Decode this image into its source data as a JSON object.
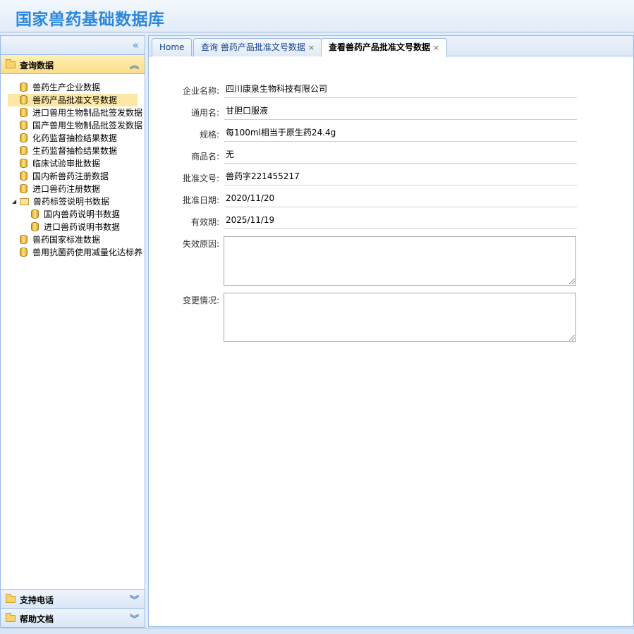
{
  "app": {
    "title": "国家兽药基础数据库"
  },
  "sidebar": {
    "collapse_icon": "double-chevron-left-icon",
    "sections": [
      {
        "label": "查询数据",
        "active": true
      },
      {
        "label": "支持电话",
        "active": false
      },
      {
        "label": "帮助文档",
        "active": false
      }
    ],
    "tree": [
      {
        "label": "兽药生产企业数据",
        "level": 1,
        "type": "db"
      },
      {
        "label": "兽药产品批准文号数据",
        "level": 1,
        "type": "db",
        "selected": true
      },
      {
        "label": "进口兽用生物制品批签发数据",
        "level": 1,
        "type": "db"
      },
      {
        "label": "国产兽用生物制品批签发数据",
        "level": 1,
        "type": "db"
      },
      {
        "label": "化药监督抽检结果数据",
        "level": 1,
        "type": "db"
      },
      {
        "label": "生药监督抽检结果数据",
        "level": 1,
        "type": "db"
      },
      {
        "label": "临床试验审批数据",
        "level": 1,
        "type": "db"
      },
      {
        "label": "国内新兽药注册数据",
        "level": 1,
        "type": "db"
      },
      {
        "label": "进口兽药注册数据",
        "level": 1,
        "type": "db"
      },
      {
        "label": "兽药标签说明书数据",
        "level": 1,
        "type": "folder",
        "expanded": true
      },
      {
        "label": "国内兽药说明书数据",
        "level": 2,
        "type": "db"
      },
      {
        "label": "进口兽药说明书数据",
        "level": 2,
        "type": "db"
      },
      {
        "label": "兽药国家标准数据",
        "level": 1,
        "type": "db"
      },
      {
        "label": "兽用抗菌药使用减量化达标养",
        "level": 1,
        "type": "db"
      }
    ]
  },
  "tabs": [
    {
      "label": "Home",
      "closable": false,
      "active": false
    },
    {
      "label": "查询 兽药产品批准文号数据",
      "closable": true,
      "active": false
    },
    {
      "label": "查看兽药产品批准文号数据",
      "closable": true,
      "active": true
    }
  ],
  "form": {
    "fields": [
      {
        "label": "企业名称:",
        "value": "四川康泉生物科技有限公司"
      },
      {
        "label": "通用名:",
        "value": "甘胆口服液"
      },
      {
        "label": "规格:",
        "value": "每100ml相当于原生药24.4g"
      },
      {
        "label": "商品名:",
        "value": "无"
      },
      {
        "label": "批准文号:",
        "value": "兽药字221455217"
      },
      {
        "label": "批准日期:",
        "value": "2020/11/20"
      },
      {
        "label": "有效期:",
        "value": "2025/11/19"
      }
    ],
    "textareas": [
      {
        "label": "失效原因:",
        "value": ""
      },
      {
        "label": "变更情况:",
        "value": ""
      }
    ]
  },
  "colors": {
    "accent": "#2a87db",
    "border": "#99bbe8",
    "selected": "#fce7a4"
  }
}
